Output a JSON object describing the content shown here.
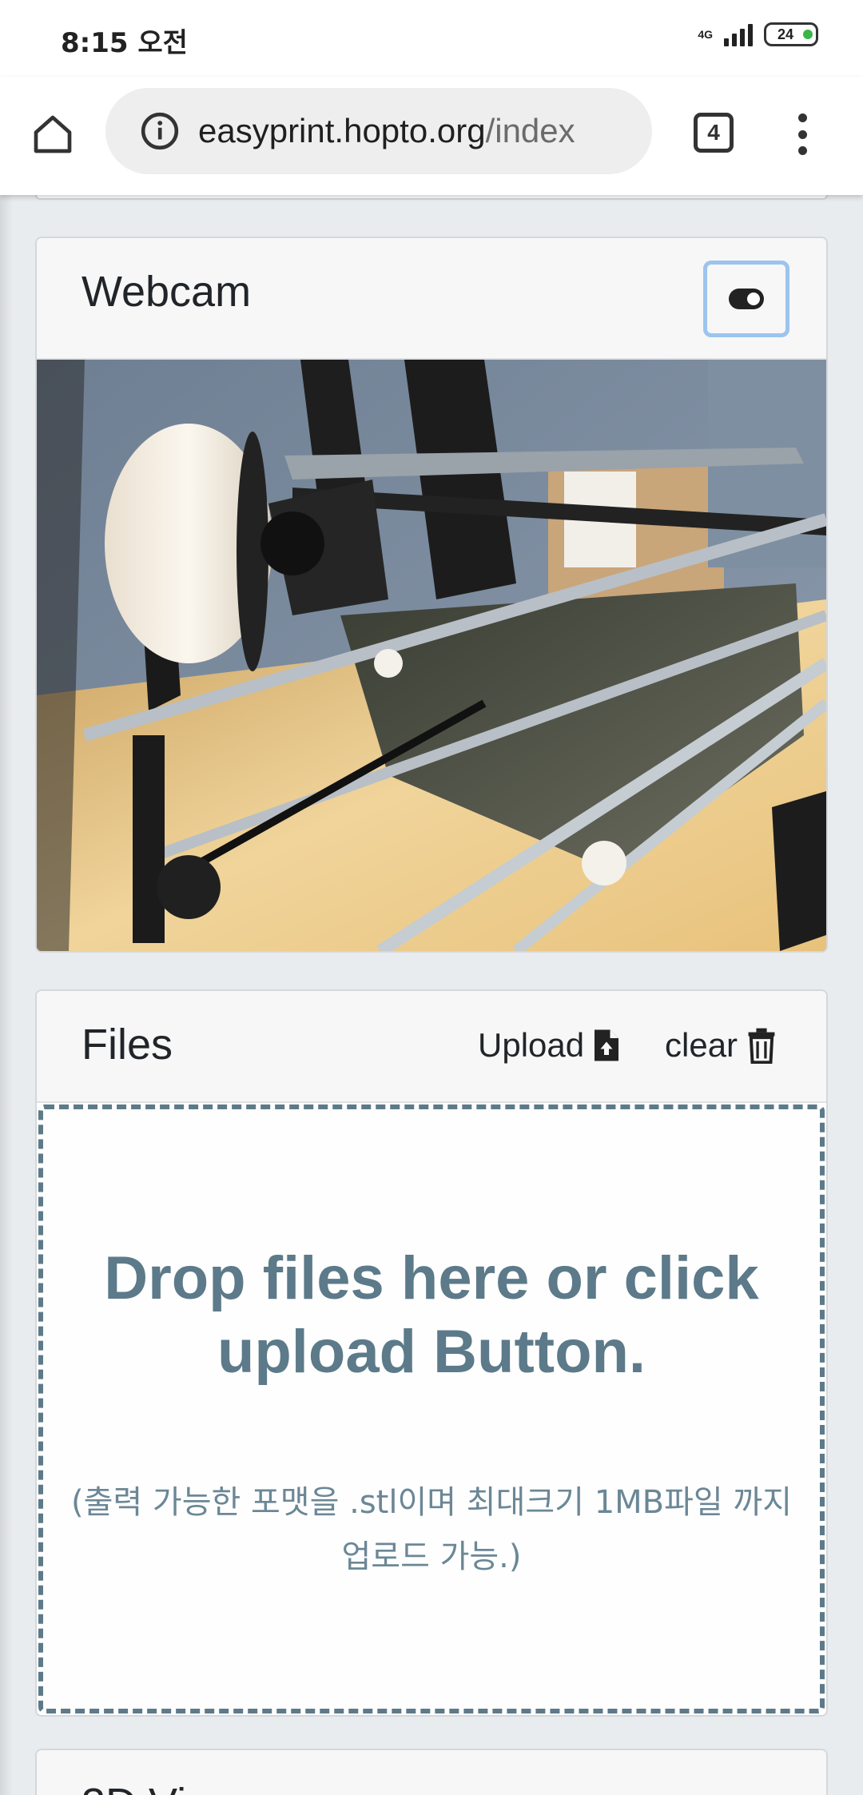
{
  "status_bar": {
    "time": "8:15 오전",
    "network": "4G",
    "battery": "24"
  },
  "browser": {
    "url_domain": "easyprint.hopto.org",
    "url_path": "/index",
    "tab_count": "4"
  },
  "webcam": {
    "title": "Webcam"
  },
  "files": {
    "title": "Files",
    "upload_label": "Upload",
    "clear_label": "clear",
    "drop_line1": "Drop files here or click",
    "drop_line2": "upload Button.",
    "drop_note": "(출력 가능한 포맷을 .stl이며 최대크기 1MB파일 까지 업로드 가능.)"
  },
  "next_section": {
    "title": "3D Vi"
  },
  "colors": {
    "accent_text": "#5c7a89",
    "toggle_border": "#9cc4ee",
    "battery_dot": "#3bb54a"
  }
}
